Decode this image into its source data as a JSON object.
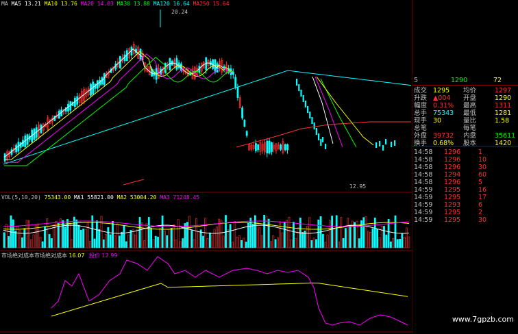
{
  "price_legend": {
    "prefix": "MA",
    "items": [
      {
        "name": "MA5",
        "value": "13.21",
        "color": "#ffffff"
      },
      {
        "name": "MA10",
        "value": "13.76",
        "color": "#ffff00"
      },
      {
        "name": "MA20",
        "value": "14.03",
        "color": "#ff00ff"
      },
      {
        "name": "MA30",
        "value": "13.88",
        "color": "#00ff00"
      },
      {
        "name": "MA120",
        "value": "16.64",
        "color": "#00ffff"
      },
      {
        "name": "MA250",
        "value": "15.64",
        "color": "#ff3030"
      }
    ]
  },
  "annotations": {
    "high": "20.24",
    "low": "12.95"
  },
  "vol_legend": {
    "label": "VOL(5,10,20)",
    "items": [
      {
        "value": "75343.00",
        "color": "#ffff00"
      },
      {
        "name": "MA1",
        "value": "55821.00",
        "color": "#ffffff"
      },
      {
        "name": "MA2",
        "value": "53004.20",
        "color": "#ffff00"
      },
      {
        "name": "MA3",
        "value": "71248.45",
        "color": "#ff00ff"
      }
    ]
  },
  "indicator_legend": {
    "label": "市场绝对成本市场绝对成本",
    "value1": "16.07",
    "label2": "股价",
    "value2": "12.99"
  },
  "quote_panel": {
    "top_row": {
      "c1": "5",
      "c2": "1290",
      "c3": "72"
    },
    "rows": [
      {
        "l": "成交",
        "v": "1295",
        "l2": "均价",
        "v2": "1297"
      },
      {
        "l": "升跌",
        "v": "▲004",
        "l2": "开盘",
        "v2": "1290"
      },
      {
        "l": "幅度",
        "v": "0.31%",
        "l2": "最高",
        "v2": "1311"
      },
      {
        "l": "总手",
        "v": "75343",
        "l2": "最低",
        "v2": "1281"
      },
      {
        "l": "现手",
        "v": "30",
        "l2": "量比",
        "v2": "1.58"
      },
      {
        "l": "总笔",
        "v": "",
        "l2": "每笔",
        "v2": ""
      },
      {
        "l": "外盘",
        "v": "39732",
        "l2": "内盘",
        "v2": "35611"
      },
      {
        "l": "换手",
        "v": "0.68%",
        "l2": "股本",
        "v2": "1420"
      }
    ],
    "trades": [
      {
        "time": "14:58",
        "price": "1296",
        "vol": "1"
      },
      {
        "time": "14:58",
        "price": "1296",
        "vol": "10"
      },
      {
        "time": "14:58",
        "price": "1296",
        "vol": "30"
      },
      {
        "time": "14:58",
        "price": "1294",
        "vol": "60"
      },
      {
        "time": "14:58",
        "price": "1296",
        "vol": "5"
      },
      {
        "time": "14:59",
        "price": "1295",
        "vol": "16"
      },
      {
        "time": "14:59",
        "price": "1295",
        "vol": "17"
      },
      {
        "time": "14:59",
        "price": "1293",
        "vol": "6"
      },
      {
        "time": "14:59",
        "price": "1295",
        "vol": "2"
      },
      {
        "time": "14:59",
        "price": "1295",
        "vol": "30"
      }
    ]
  },
  "watermark": "www.7gpzb.com",
  "colors": {
    "up": "#ff3030",
    "down": "#00ffff",
    "text": "#c0c0c0"
  }
}
